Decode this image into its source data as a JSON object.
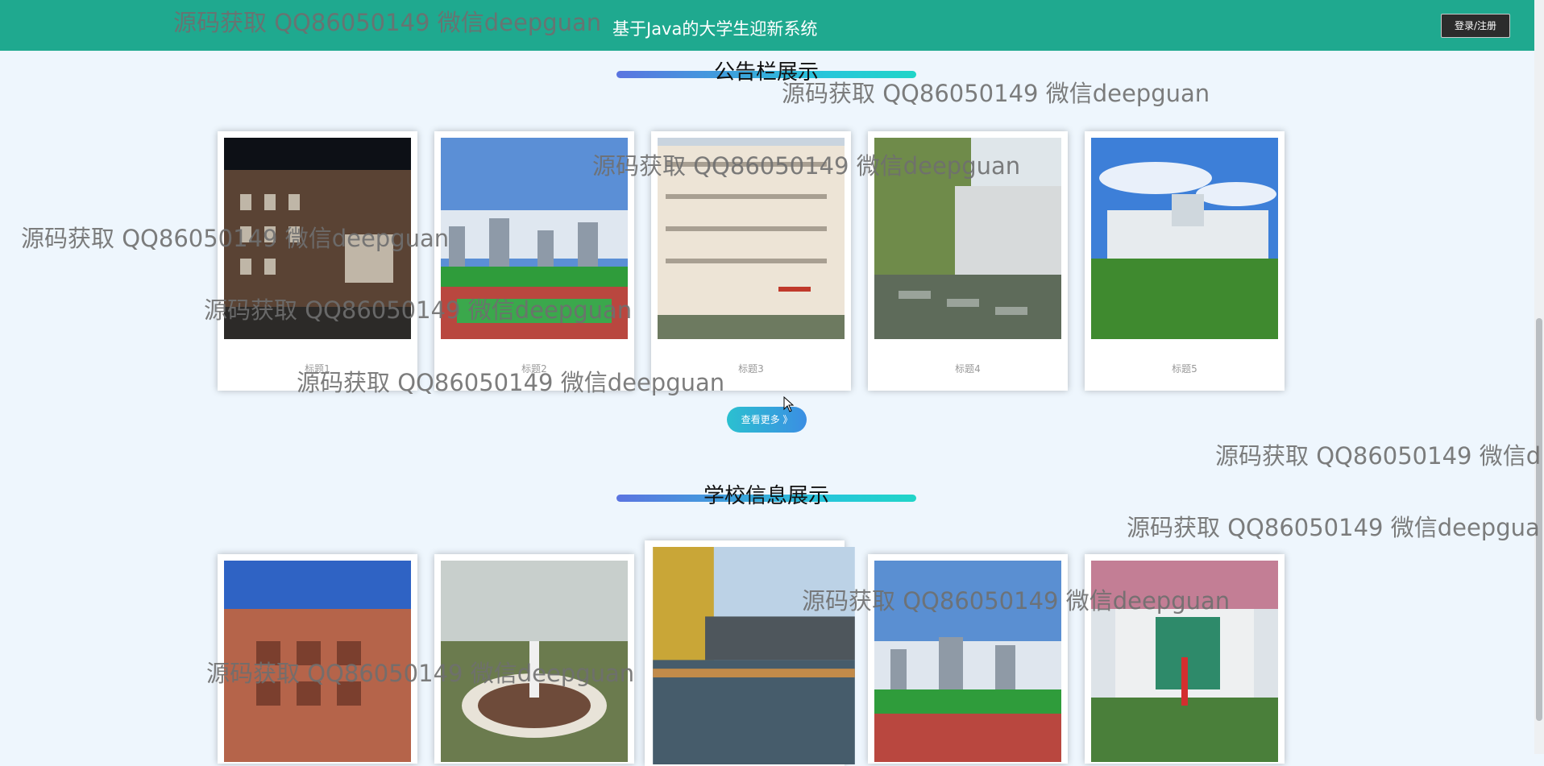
{
  "header": {
    "site_title": "基于Java的大学生迎新系统",
    "login_label": "登录/注册"
  },
  "notice_section": {
    "title": "公告栏展示",
    "cards": [
      {
        "caption": "标题1"
      },
      {
        "caption": "标题2"
      },
      {
        "caption": "标题3"
      },
      {
        "caption": "标题4"
      },
      {
        "caption": "标题5"
      }
    ],
    "more_label": "查看更多 》"
  },
  "school_section": {
    "title": "学校信息展示"
  },
  "watermark": "源码获取 QQ86050149 微信deepguan",
  "watermark_cut_1": "源码获取 QQ86050149 微信d",
  "watermark_cut_2": "源码获取 QQ86050149 微信deepgua",
  "colors": {
    "header": "#1fa98f",
    "background": "#eef6fd",
    "accent_gradient_start": "#5b74e0",
    "accent_gradient_end": "#20d5c8"
  }
}
